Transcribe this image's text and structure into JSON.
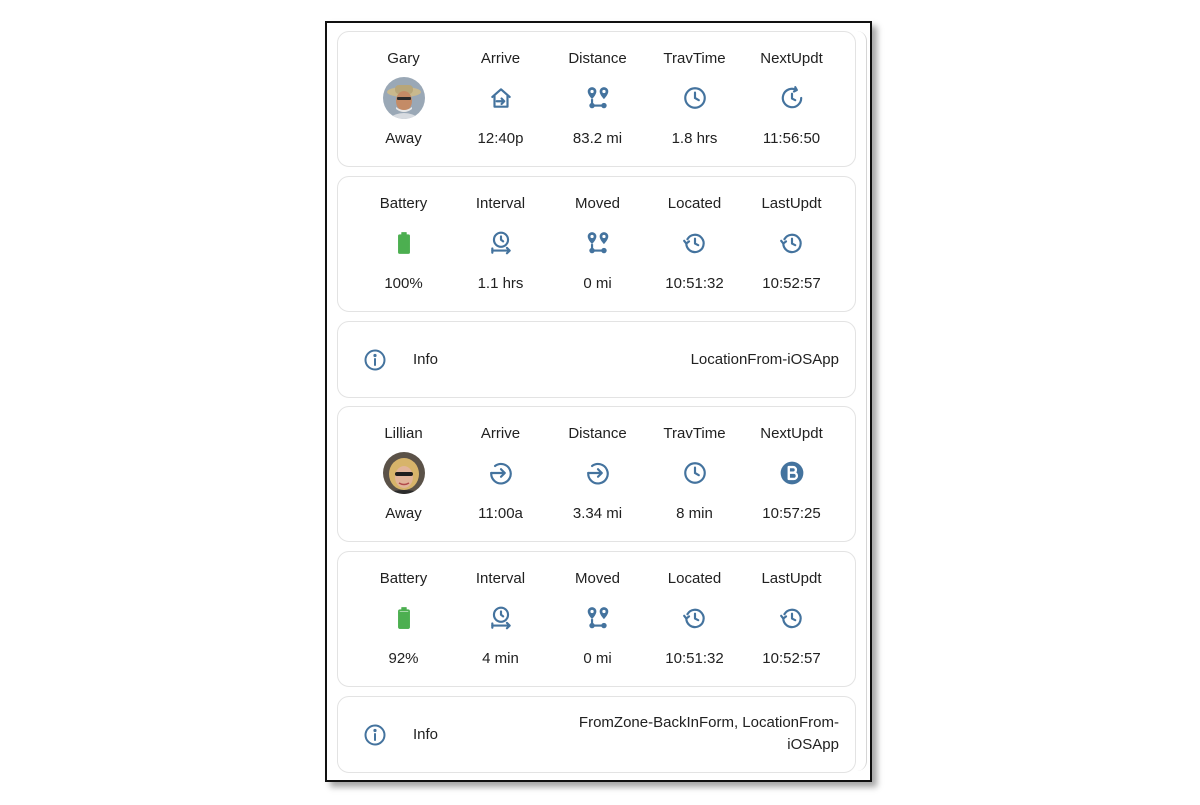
{
  "people": [
    {
      "stats": [
        {
          "label": "Gary",
          "icon": "avatar-gary",
          "value": "Away"
        },
        {
          "label": "Arrive",
          "icon": "home-arrow-icon",
          "value": "12:40p"
        },
        {
          "label": "Distance",
          "icon": "map-marker-distance-icon",
          "value": "83.2 mi"
        },
        {
          "label": "TravTime",
          "icon": "clock-outline-icon",
          "value": "1.8 hrs"
        },
        {
          "label": "NextUpdt",
          "icon": "clock-refresh-icon",
          "value": "11:56:50"
        }
      ],
      "device": [
        {
          "label": "Battery",
          "icon": "battery-full-icon",
          "value": "100%"
        },
        {
          "label": "Interval",
          "icon": "timer-interval-icon",
          "value": "1.1 hrs"
        },
        {
          "label": "Moved",
          "icon": "map-marker-distance-icon",
          "value": "0 mi"
        },
        {
          "label": "Located",
          "icon": "history-icon",
          "value": "10:51:32"
        },
        {
          "label": "LastUpdt",
          "icon": "history-icon",
          "value": "10:52:57"
        }
      ],
      "info": {
        "label": "Info",
        "value": "LocationFrom-iOSApp"
      }
    },
    {
      "stats": [
        {
          "label": "Lillian",
          "icon": "avatar-lillian",
          "value": "Away"
        },
        {
          "label": "Arrive",
          "icon": "arrow-right-circle-icon",
          "value": "11:00a"
        },
        {
          "label": "Distance",
          "icon": "arrow-right-circle-icon",
          "value": "3.34 mi"
        },
        {
          "label": "TravTime",
          "icon": "clock-outline-icon",
          "value": "8 min"
        },
        {
          "label": "NextUpdt",
          "icon": "letter-b-circle-icon",
          "value": "10:57:25"
        }
      ],
      "device": [
        {
          "label": "Battery",
          "icon": "battery-high-icon",
          "value": "92%"
        },
        {
          "label": "Interval",
          "icon": "timer-interval-icon",
          "value": "4 min"
        },
        {
          "label": "Moved",
          "icon": "map-marker-distance-icon",
          "value": "0 mi"
        },
        {
          "label": "Located",
          "icon": "history-icon",
          "value": "10:51:32"
        },
        {
          "label": "LastUpdt",
          "icon": "history-icon",
          "value": "10:52:57"
        }
      ],
      "info": {
        "label": "Info",
        "value": "FromZone-BackInForm, LocationFrom-iOSApp"
      }
    }
  ],
  "colors": {
    "icon": "#44739e",
    "battery": "#4caf50",
    "text": "#212121",
    "card_border": "#e3e3e3"
  }
}
